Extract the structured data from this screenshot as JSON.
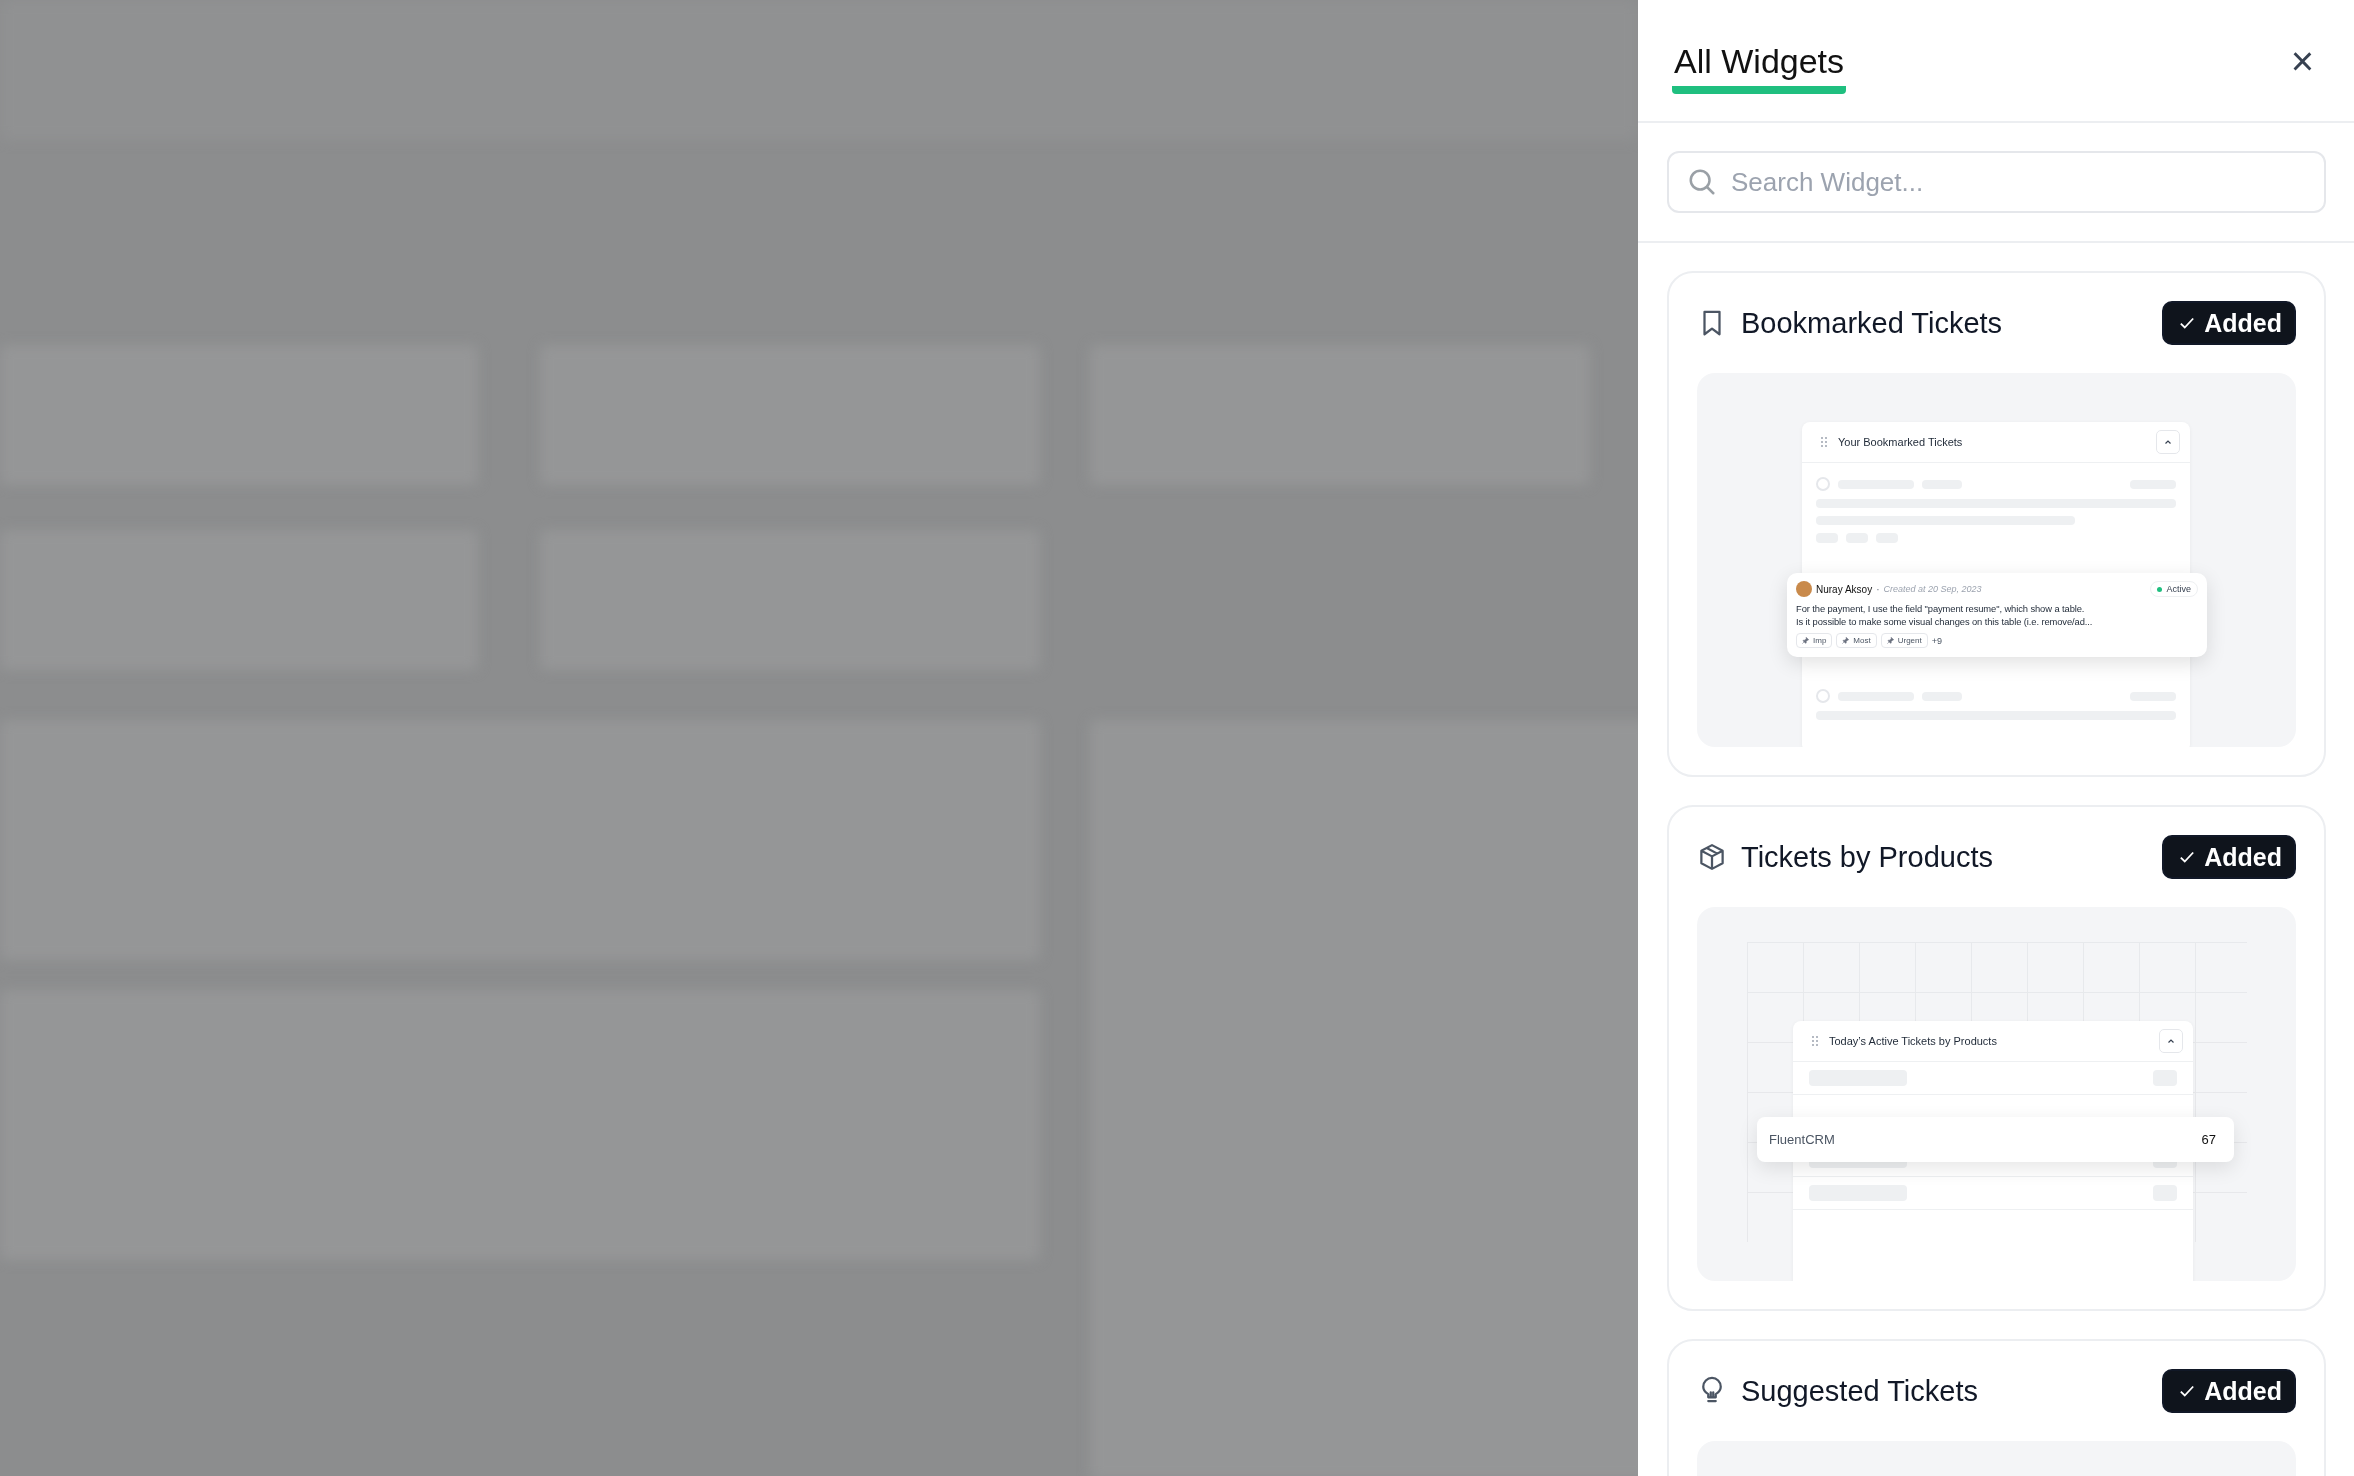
{
  "panel": {
    "title": "All Widgets",
    "close_label": "×",
    "search": {
      "placeholder": "Search Widget..."
    }
  },
  "widgets": [
    {
      "title": "Bookmarked Tickets",
      "kind": "bookmark",
      "added": true,
      "button_label": "Added",
      "preview": {
        "kind": "ticket",
        "header": "Your Bookmarked Tickets",
        "ticket": {
          "author": "Nuray Aksoy",
          "separator": "·",
          "created": "Created at 20 Sep, 2023",
          "status": "Active",
          "body_lines": [
            "For the payment, I use the field \"payment resume\", which show a table.",
            "Is it possible to make some visual changes on this table (i.e. remove/ad..."
          ],
          "tags": [
            "Imp",
            "Most",
            "Urgent"
          ],
          "more": "+9"
        }
      }
    },
    {
      "title": "Tickets by Products",
      "kind": "cube",
      "added": true,
      "button_label": "Added",
      "preview": {
        "kind": "products",
        "header": "Today’s Active Tickets by Products",
        "row": {
          "name": "FluentCRM",
          "count": "67"
        }
      }
    },
    {
      "title": "Suggested Tickets",
      "kind": "bulb",
      "added": true,
      "button_label": "Added",
      "preview": {
        "kind": "blank"
      }
    }
  ]
}
